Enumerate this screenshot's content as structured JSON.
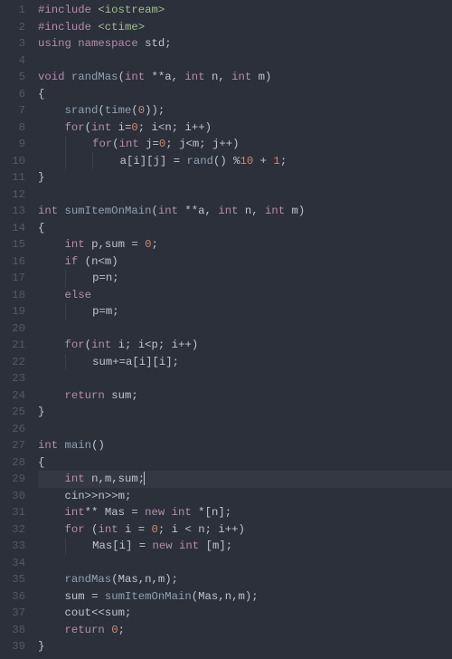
{
  "editor": {
    "active_line": 29,
    "cursor_after_col": 16,
    "lines": [
      {
        "n": 1,
        "tokens": [
          [
            "inc",
            "#include "
          ],
          [
            "hdr",
            "<iostream>"
          ]
        ]
      },
      {
        "n": 2,
        "tokens": [
          [
            "inc",
            "#include "
          ],
          [
            "hdr",
            "<ctime>"
          ]
        ]
      },
      {
        "n": 3,
        "tokens": [
          [
            "kw",
            "using "
          ],
          [
            "kw",
            "namespace "
          ],
          [
            "id",
            "std"
          ],
          [
            "punc",
            ";"
          ]
        ]
      },
      {
        "n": 4,
        "tokens": []
      },
      {
        "n": 5,
        "tokens": [
          [
            "kw",
            "void "
          ],
          [
            "fn",
            "randMas"
          ],
          [
            "punc",
            "("
          ],
          [
            "kw",
            "int "
          ],
          [
            "op",
            "**"
          ],
          [
            "id",
            "a"
          ],
          [
            "punc",
            ", "
          ],
          [
            "kw",
            "int "
          ],
          [
            "id",
            "n"
          ],
          [
            "punc",
            ", "
          ],
          [
            "kw",
            "int "
          ],
          [
            "id",
            "m"
          ],
          [
            "punc",
            ")"
          ]
        ]
      },
      {
        "n": 6,
        "tokens": [
          [
            "punc",
            "{"
          ]
        ]
      },
      {
        "n": 7,
        "tokens": [
          [
            "ws",
            "    "
          ],
          [
            "call",
            "srand"
          ],
          [
            "punc",
            "("
          ],
          [
            "call",
            "time"
          ],
          [
            "punc",
            "("
          ],
          [
            "num",
            "0"
          ],
          [
            "punc",
            "));"
          ]
        ]
      },
      {
        "n": 8,
        "tokens": [
          [
            "ws",
            "    "
          ],
          [
            "kw",
            "for"
          ],
          [
            "punc",
            "("
          ],
          [
            "kw",
            "int "
          ],
          [
            "id",
            "i"
          ],
          [
            "op",
            "="
          ],
          [
            "num",
            "0"
          ],
          [
            "punc",
            "; "
          ],
          [
            "id",
            "i"
          ],
          [
            "op",
            "<"
          ],
          [
            "id",
            "n"
          ],
          [
            "punc",
            "; "
          ],
          [
            "id",
            "i"
          ],
          [
            "op",
            "++"
          ],
          [
            "punc",
            ")"
          ]
        ]
      },
      {
        "n": 9,
        "tokens": [
          [
            "ws",
            "        "
          ],
          [
            "kw",
            "for"
          ],
          [
            "punc",
            "("
          ],
          [
            "kw",
            "int "
          ],
          [
            "id",
            "j"
          ],
          [
            "op",
            "="
          ],
          [
            "num",
            "0"
          ],
          [
            "punc",
            "; "
          ],
          [
            "id",
            "j"
          ],
          [
            "op",
            "<"
          ],
          [
            "id",
            "m"
          ],
          [
            "punc",
            "; "
          ],
          [
            "id",
            "j"
          ],
          [
            "op",
            "++"
          ],
          [
            "punc",
            ")"
          ]
        ]
      },
      {
        "n": 10,
        "tokens": [
          [
            "ws",
            "            "
          ],
          [
            "id",
            "a"
          ],
          [
            "punc",
            "["
          ],
          [
            "id",
            "i"
          ],
          [
            "punc",
            "]["
          ],
          [
            "id",
            "j"
          ],
          [
            "punc",
            "] "
          ],
          [
            "op",
            "= "
          ],
          [
            "call",
            "rand"
          ],
          [
            "punc",
            "() "
          ],
          [
            "op",
            "%"
          ],
          [
            "num",
            "10"
          ],
          [
            "op",
            " + "
          ],
          [
            "num",
            "1"
          ],
          [
            "punc",
            ";"
          ]
        ]
      },
      {
        "n": 11,
        "tokens": [
          [
            "punc",
            "}"
          ]
        ]
      },
      {
        "n": 12,
        "tokens": []
      },
      {
        "n": 13,
        "tokens": [
          [
            "kw",
            "int "
          ],
          [
            "fn",
            "sumItemOnMain"
          ],
          [
            "punc",
            "("
          ],
          [
            "kw",
            "int "
          ],
          [
            "op",
            "**"
          ],
          [
            "id",
            "a"
          ],
          [
            "punc",
            ", "
          ],
          [
            "kw",
            "int "
          ],
          [
            "id",
            "n"
          ],
          [
            "punc",
            ", "
          ],
          [
            "kw",
            "int "
          ],
          [
            "id",
            "m"
          ],
          [
            "punc",
            ")"
          ]
        ]
      },
      {
        "n": 14,
        "tokens": [
          [
            "punc",
            "{"
          ]
        ]
      },
      {
        "n": 15,
        "tokens": [
          [
            "ws",
            "    "
          ],
          [
            "kw",
            "int "
          ],
          [
            "id",
            "p"
          ],
          [
            "punc",
            ","
          ],
          [
            "id",
            "sum "
          ],
          [
            "op",
            "= "
          ],
          [
            "num",
            "0"
          ],
          [
            "punc",
            ";"
          ]
        ]
      },
      {
        "n": 16,
        "tokens": [
          [
            "ws",
            "    "
          ],
          [
            "kw",
            "if "
          ],
          [
            "punc",
            "("
          ],
          [
            "id",
            "n"
          ],
          [
            "op",
            "<"
          ],
          [
            "id",
            "m"
          ],
          [
            "punc",
            ")"
          ]
        ]
      },
      {
        "n": 17,
        "tokens": [
          [
            "ws",
            "        "
          ],
          [
            "id",
            "p"
          ],
          [
            "op",
            "="
          ],
          [
            "id",
            "n"
          ],
          [
            "punc",
            ";"
          ]
        ]
      },
      {
        "n": 18,
        "tokens": [
          [
            "ws",
            "    "
          ],
          [
            "kw",
            "else"
          ]
        ]
      },
      {
        "n": 19,
        "tokens": [
          [
            "ws",
            "        "
          ],
          [
            "id",
            "p"
          ],
          [
            "op",
            "="
          ],
          [
            "id",
            "m"
          ],
          [
            "punc",
            ";"
          ]
        ]
      },
      {
        "n": 20,
        "tokens": []
      },
      {
        "n": 21,
        "tokens": [
          [
            "ws",
            "    "
          ],
          [
            "kw",
            "for"
          ],
          [
            "punc",
            "("
          ],
          [
            "kw",
            "int "
          ],
          [
            "id",
            "i"
          ],
          [
            "punc",
            "; "
          ],
          [
            "id",
            "i"
          ],
          [
            "op",
            "<"
          ],
          [
            "id",
            "p"
          ],
          [
            "punc",
            "; "
          ],
          [
            "id",
            "i"
          ],
          [
            "op",
            "++"
          ],
          [
            "punc",
            ")"
          ]
        ]
      },
      {
        "n": 22,
        "tokens": [
          [
            "ws",
            "        "
          ],
          [
            "id",
            "sum"
          ],
          [
            "op",
            "+="
          ],
          [
            "id",
            "a"
          ],
          [
            "punc",
            "["
          ],
          [
            "id",
            "i"
          ],
          [
            "punc",
            "]["
          ],
          [
            "id",
            "i"
          ],
          [
            "punc",
            "];"
          ]
        ]
      },
      {
        "n": 23,
        "tokens": []
      },
      {
        "n": 24,
        "tokens": [
          [
            "ws",
            "    "
          ],
          [
            "kw",
            "return "
          ],
          [
            "id",
            "sum"
          ],
          [
            "punc",
            ";"
          ]
        ]
      },
      {
        "n": 25,
        "tokens": [
          [
            "punc",
            "}"
          ]
        ]
      },
      {
        "n": 26,
        "tokens": []
      },
      {
        "n": 27,
        "tokens": [
          [
            "kw",
            "int "
          ],
          [
            "fn",
            "main"
          ],
          [
            "punc",
            "()"
          ]
        ]
      },
      {
        "n": 28,
        "tokens": [
          [
            "punc",
            "{"
          ]
        ]
      },
      {
        "n": 29,
        "tokens": [
          [
            "ws",
            "    "
          ],
          [
            "kw",
            "int "
          ],
          [
            "id",
            "n"
          ],
          [
            "punc",
            ","
          ],
          [
            "id",
            "m"
          ],
          [
            "punc",
            ","
          ],
          [
            "id",
            "sum"
          ],
          [
            "punc",
            ";"
          ]
        ]
      },
      {
        "n": 30,
        "tokens": [
          [
            "ws",
            "    "
          ],
          [
            "id",
            "cin"
          ],
          [
            "op",
            ">>"
          ],
          [
            "id",
            "n"
          ],
          [
            "op",
            ">>"
          ],
          [
            "id",
            "m"
          ],
          [
            "punc",
            ";"
          ]
        ]
      },
      {
        "n": 31,
        "tokens": [
          [
            "ws",
            "    "
          ],
          [
            "kw",
            "int"
          ],
          [
            "op",
            "** "
          ],
          [
            "id",
            "Mas "
          ],
          [
            "op",
            "= "
          ],
          [
            "kw",
            "new "
          ],
          [
            "kw",
            "int "
          ],
          [
            "op",
            "*"
          ],
          [
            "punc",
            "["
          ],
          [
            "id",
            "n"
          ],
          [
            "punc",
            "];"
          ]
        ]
      },
      {
        "n": 32,
        "tokens": [
          [
            "ws",
            "    "
          ],
          [
            "kw",
            "for "
          ],
          [
            "punc",
            "("
          ],
          [
            "kw",
            "int "
          ],
          [
            "id",
            "i "
          ],
          [
            "op",
            "= "
          ],
          [
            "num",
            "0"
          ],
          [
            "punc",
            "; "
          ],
          [
            "id",
            "i "
          ],
          [
            "op",
            "< "
          ],
          [
            "id",
            "n"
          ],
          [
            "punc",
            "; "
          ],
          [
            "id",
            "i"
          ],
          [
            "op",
            "++"
          ],
          [
            "punc",
            ")"
          ]
        ]
      },
      {
        "n": 33,
        "tokens": [
          [
            "ws",
            "        "
          ],
          [
            "id",
            "Mas"
          ],
          [
            "punc",
            "["
          ],
          [
            "id",
            "i"
          ],
          [
            "punc",
            "] "
          ],
          [
            "op",
            "= "
          ],
          [
            "kw",
            "new "
          ],
          [
            "kw",
            "int "
          ],
          [
            "punc",
            "["
          ],
          [
            "id",
            "m"
          ],
          [
            "punc",
            "];"
          ]
        ]
      },
      {
        "n": 34,
        "tokens": []
      },
      {
        "n": 35,
        "tokens": [
          [
            "ws",
            "    "
          ],
          [
            "call",
            "randMas"
          ],
          [
            "punc",
            "("
          ],
          [
            "id",
            "Mas"
          ],
          [
            "punc",
            ","
          ],
          [
            "id",
            "n"
          ],
          [
            "punc",
            ","
          ],
          [
            "id",
            "m"
          ],
          [
            "punc",
            ");"
          ]
        ]
      },
      {
        "n": 36,
        "tokens": [
          [
            "ws",
            "    "
          ],
          [
            "id",
            "sum "
          ],
          [
            "op",
            "= "
          ],
          [
            "call",
            "sumItemOnMain"
          ],
          [
            "punc",
            "("
          ],
          [
            "id",
            "Mas"
          ],
          [
            "punc",
            ","
          ],
          [
            "id",
            "n"
          ],
          [
            "punc",
            ","
          ],
          [
            "id",
            "m"
          ],
          [
            "punc",
            ");"
          ]
        ]
      },
      {
        "n": 37,
        "tokens": [
          [
            "ws",
            "    "
          ],
          [
            "id",
            "cout"
          ],
          [
            "op",
            "<<"
          ],
          [
            "id",
            "sum"
          ],
          [
            "punc",
            ";"
          ]
        ]
      },
      {
        "n": 38,
        "tokens": [
          [
            "ws",
            "    "
          ],
          [
            "kw",
            "return "
          ],
          [
            "num",
            "0"
          ],
          [
            "punc",
            ";"
          ]
        ]
      },
      {
        "n": 39,
        "tokens": [
          [
            "punc",
            "}"
          ]
        ]
      }
    ]
  }
}
